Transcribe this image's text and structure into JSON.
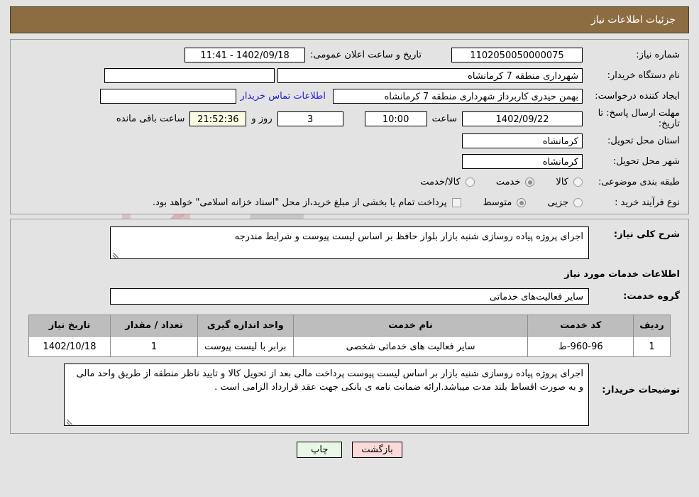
{
  "header": {
    "title": "جزئیات اطلاعات نیاز"
  },
  "top_form": {
    "need_number_label": "شماره نیاز:",
    "need_number_value": "1102050050000075",
    "announce_label": "تاریخ و ساعت اعلان عمومی:",
    "announce_value": "1402/09/18 - 11:41",
    "buyer_org_label": "نام دستگاه خریدار:",
    "buyer_org_value": "شهرداری منطقه 7 کرمانشاه",
    "empty_field_value": "",
    "creator_label": "ایجاد کننده درخواست:",
    "creator_value": "بهمن حیدری کاربرداز شهرداری منطقه 7 کرمانشاه",
    "contact_link": "اطلاعات تماس خریدار",
    "deadline_label": "مهلت ارسال پاسخ: تا تاریخ:",
    "deadline_date": "1402/09/22",
    "hour_label": "ساعت",
    "deadline_time": "10:00",
    "days_value": "3",
    "days_label": "روز و",
    "countdown_value": "21:52:36",
    "countdown_label": "ساعت باقی مانده",
    "province_label": "استان محل تحویل:",
    "province_value": "کرمانشاه",
    "city_label": "شهر محل تحویل:",
    "city_value": "کرمانشاه",
    "classification_label": "طبقه بندی موضوعی:",
    "classification_options": [
      {
        "label": "کالا",
        "selected": false
      },
      {
        "label": "خدمت",
        "selected": true
      },
      {
        "label": "کالا/خدمت",
        "selected": false
      }
    ],
    "process_label": "نوع فرآیند خرید :",
    "process_options": [
      {
        "label": "جزیی",
        "selected": false
      },
      {
        "label": "متوسط",
        "selected": true
      }
    ],
    "treasury_checkbox_checked": false,
    "treasury_note": "پرداخت تمام یا بخشی از مبلغ خرید،از محل \"اسناد خزانه اسلامی\" خواهد بود."
  },
  "detail": {
    "general_desc_label": "شرح کلی نیاز:",
    "general_desc_value": "اجرای پروژه پیاده روسازی شنبه بازار بلوار حافظ بر اساس لیست پیوست و شرایط مندرجه",
    "services_section_title": "اطلاعات خدمات مورد نیاز",
    "service_group_label": "گروه خدمت:",
    "service_group_value": "سایر فعالیت‌های خدماتی",
    "buyer_notes_label": "توضیحات خریدار:",
    "buyer_notes_value": "اجرای پروژه پیاده روسازی شنبه بازار بر اساس لیست پیوست پرداخت مالی بعد از تحویل کالا و تایید ناظر منطقه از طریق واحد مالی و به صورت اقساط بلند مدت میباشد.ارائه ضمانت نامه ی بانکی جهت عقد قرارداد الزامی است ."
  },
  "items_table": {
    "columns": [
      "ردیف",
      "کد خدمت",
      "نام خدمت",
      "واحد اندازه گیری",
      "تعداد / مقدار",
      "تاریخ نیاز"
    ],
    "rows": [
      {
        "index": "1",
        "code": "960-96-ط",
        "name": "سایر فعالیت های خدماتی شخصی",
        "unit": "برابر با لیست پیوست",
        "quantity": "1",
        "need_date": "1402/10/18"
      }
    ]
  },
  "footer": {
    "print_label": "چاپ",
    "return_label": "بازگشت"
  },
  "watermark": {
    "text": "AriaTender.net"
  },
  "colors": {
    "header_bar": "#8c6d41",
    "page_background": "#e3e3e3",
    "link": "#2020dd",
    "table_header": "#bdbdbd",
    "countdown_background": "#fbfbe4",
    "print_button": "#e9f7e9",
    "return_button": "#fbdada"
  }
}
